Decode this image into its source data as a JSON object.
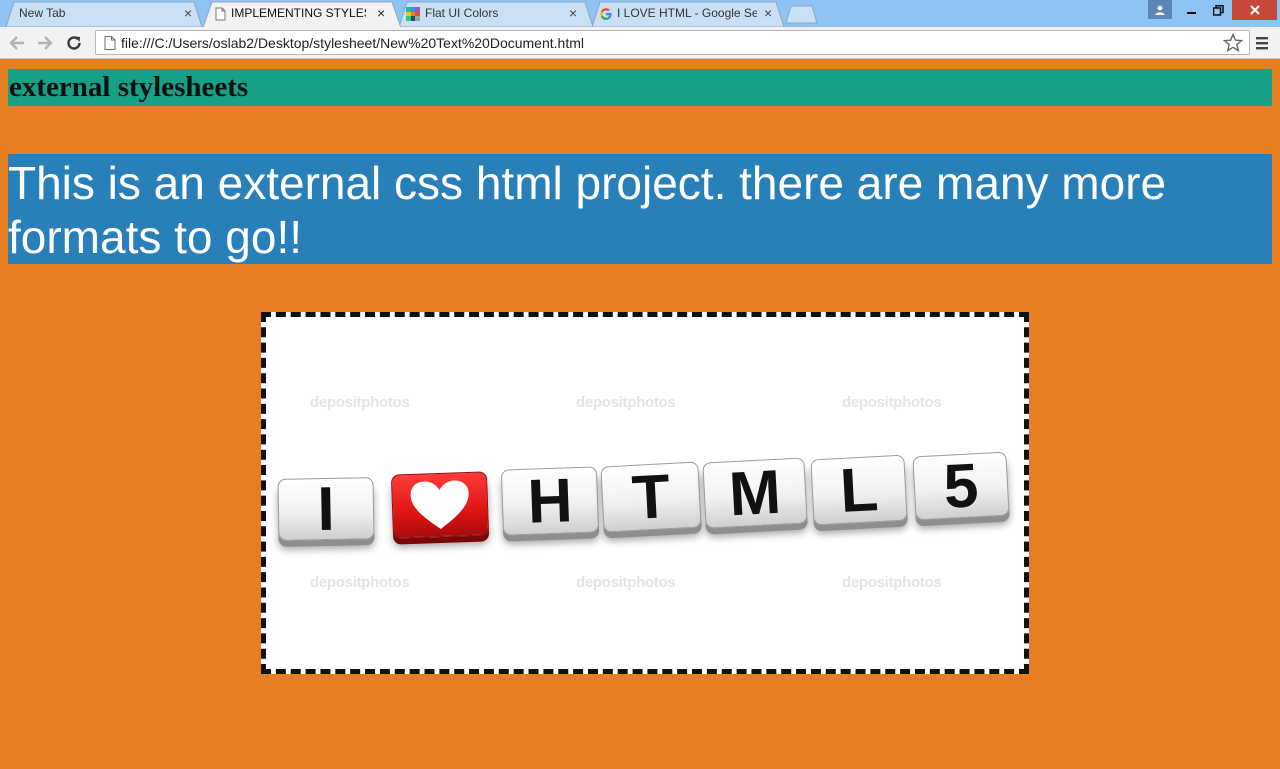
{
  "browser": {
    "tabs": [
      {
        "title": "New Tab",
        "favicon": "none"
      },
      {
        "title": "IMPLEMENTING STYLESHE",
        "favicon": "page-icon"
      },
      {
        "title": "Flat UI Colors",
        "favicon": "flat-ui-icon"
      },
      {
        "title": "I LOVE HTML - Google Se",
        "favicon": "google-icon"
      }
    ],
    "tab_close": "×",
    "address_bar": {
      "url": "file:///C:/Users/oslab2/Desktop/stylesheet/New%20Text%20Document.html"
    },
    "colors": {
      "titlebar": "#8fc3f4",
      "toolbar": "#f2f2f2",
      "close_button": "#c7473a"
    }
  },
  "page": {
    "heading": "external stylesheets",
    "paragraph": "This is an external css html project. there are many more formats to go!!",
    "image": {
      "cube_letters": [
        "I",
        "♥",
        "H",
        "T",
        "M",
        "L",
        "5"
      ],
      "watermark": "depositphotos"
    },
    "colors": {
      "background": "#e67e22",
      "heading_bg": "#16a085",
      "paragraph_bg": "#2980b9",
      "heart_cube": "#e01414"
    }
  }
}
